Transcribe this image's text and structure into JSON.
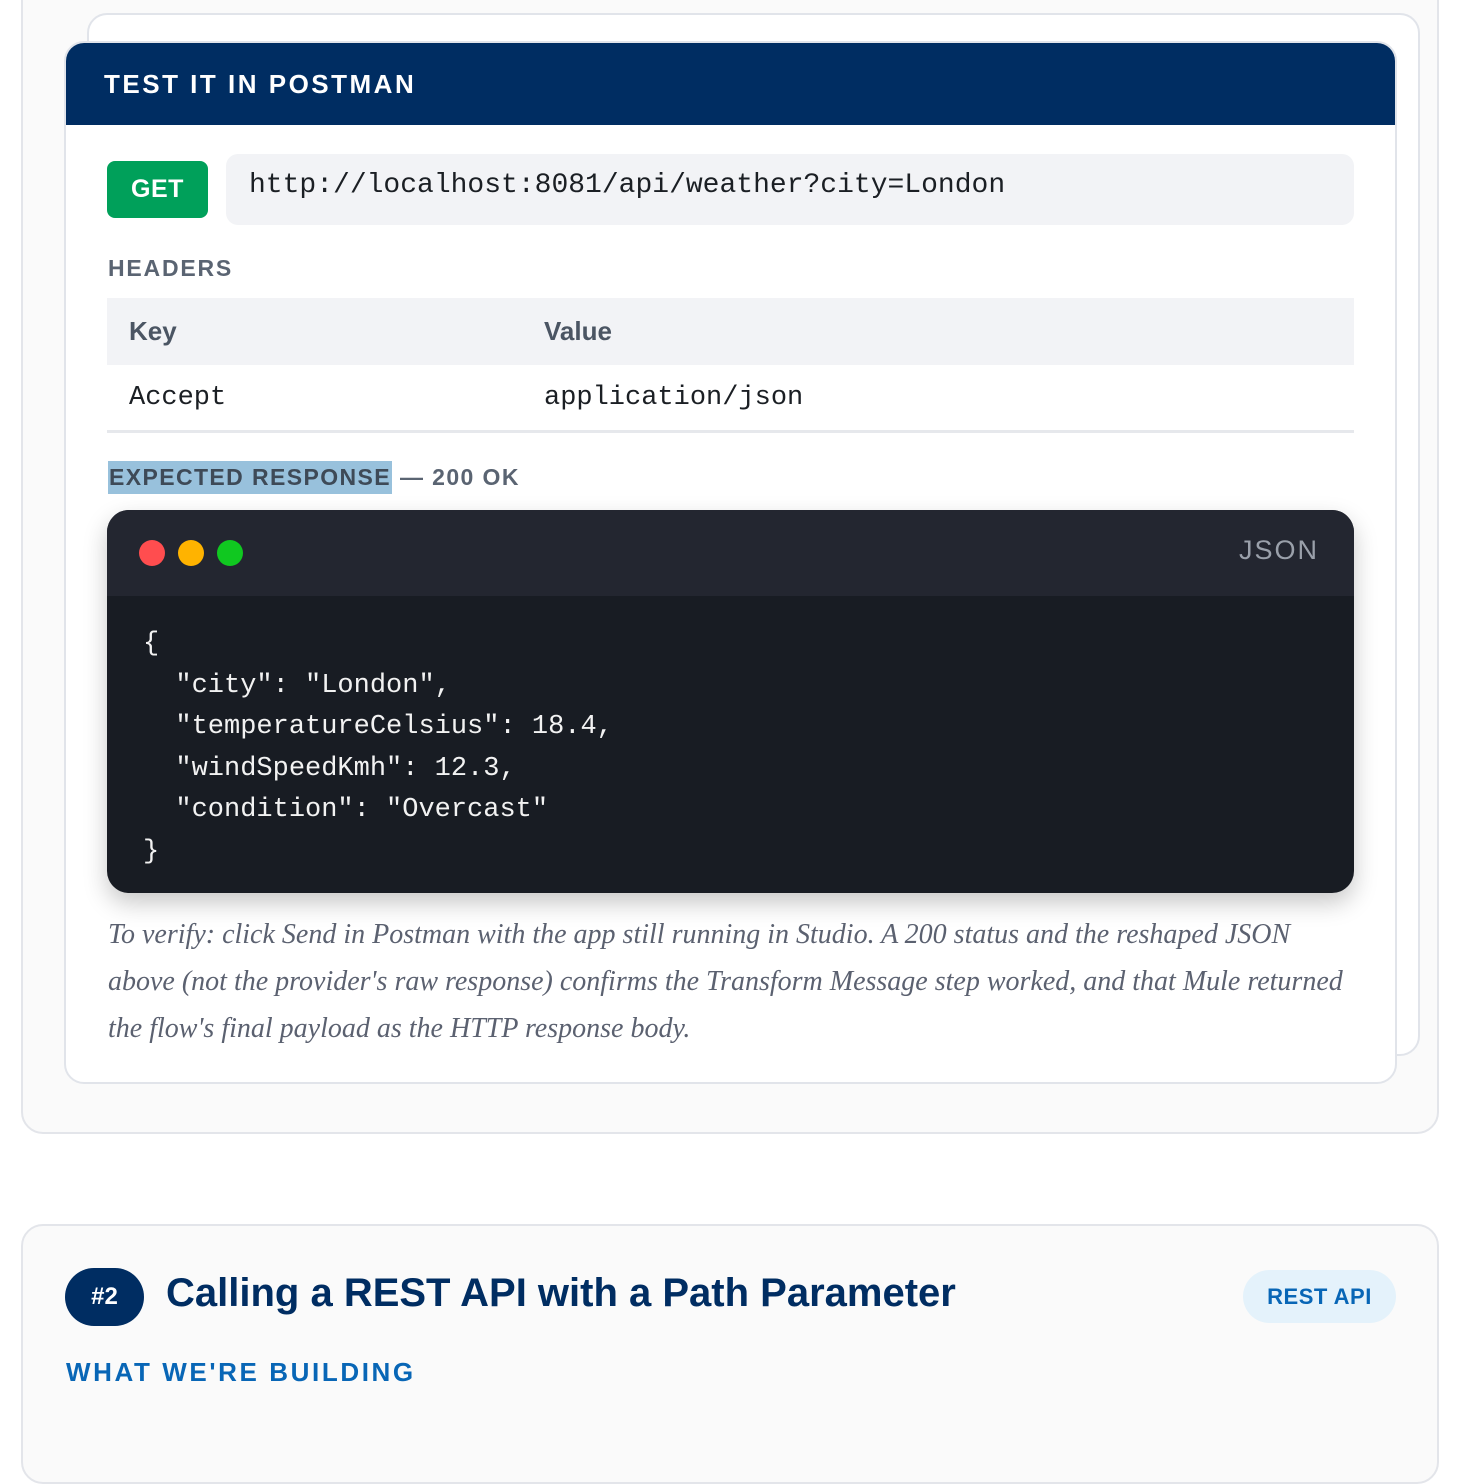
{
  "postman": {
    "title": "TEST IT IN POSTMAN",
    "method": "GET",
    "url": "http://localhost:8081/api/weather?city=London",
    "headers_label": "HEADERS",
    "headers_table": {
      "columns": [
        "Key",
        "Value"
      ],
      "rows": [
        {
          "key": "Accept",
          "value": "application/json"
        }
      ]
    },
    "response_label_highlight": "EXPECTED RESPONSE",
    "response_label_rest": "— 200 OK",
    "code_window": {
      "language": "JSON",
      "dot_colors": [
        "#ff4d4f",
        "#ffb300",
        "#10c820"
      ],
      "code": "{\n  \"city\": \"London\",\n  \"temperatureCelsius\": 18.4,\n  \"windSpeedKmh\": 12.3,\n  \"condition\": \"Overcast\"\n}"
    },
    "verify_text": "To verify: click Send in Postman with the app still running in Studio. A 200 status and the reshaped JSON above (not the provider's raw response) confirms the Transform Message step worked, and that Mule returned the flow's final payload as the HTTP response body."
  },
  "section2": {
    "number": "#2",
    "title": "Calling a REST API with a Path Parameter",
    "tag": "REST API",
    "subheading": "WHAT WE'RE BUILDING"
  },
  "colors": {
    "navy": "#002d62",
    "get_green": "#00a05a",
    "accent_blue": "#0866b6",
    "code_bg": "#181c23",
    "highlight": "#98c1dc"
  }
}
